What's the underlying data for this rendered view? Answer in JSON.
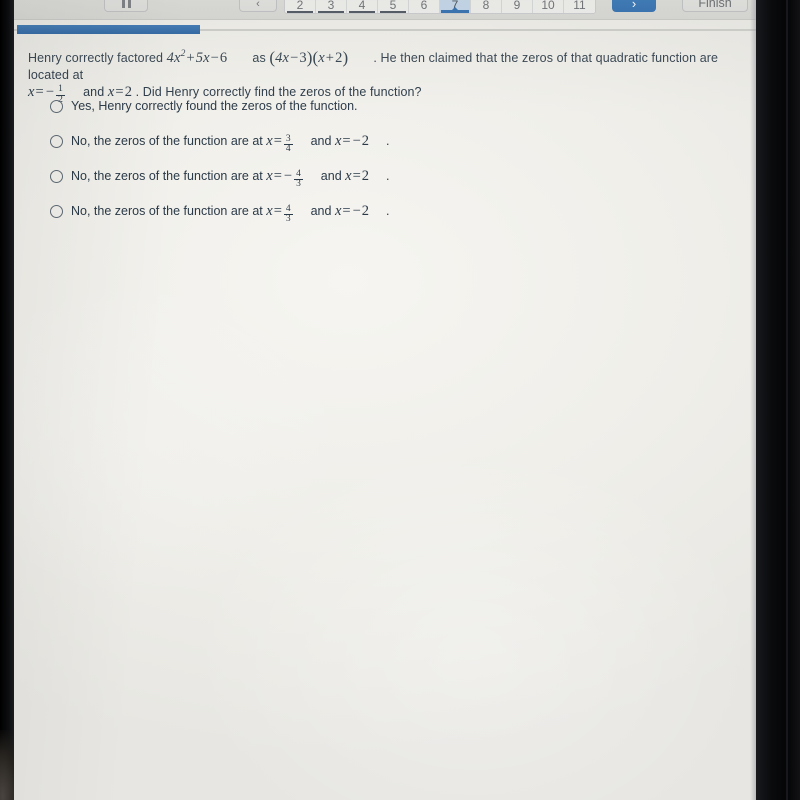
{
  "toolbar": {
    "pause_label": "pause-icon",
    "prev_label": "‹",
    "next_label": "›",
    "finish_label": "Finish",
    "pages": [
      "2",
      "3",
      "4",
      "5",
      "6",
      "7",
      "8",
      "9",
      "10",
      "11"
    ],
    "active_page": "7"
  },
  "progress": {
    "percent": 25
  },
  "question": {
    "lead": "Henry correctly factored",
    "expression": "4x² + 5x − 6",
    "connector": "as",
    "factored": "(4x − 3)(x + 2)",
    "period": ".",
    "middle": "He then claimed that the zeros of that quadratic function are located at",
    "zero1": "x = − 1/2",
    "and": "and",
    "zero2": "x = 2",
    "tail": ". Did Henry correctly find the zeros of the function?"
  },
  "options": [
    {
      "id": "option-a",
      "text": "Yes, Henry correctly found the zeros of the function.",
      "math": null
    },
    {
      "id": "option-b",
      "prefix": "No, the zeros of the function are at",
      "value1": "x = 3/4",
      "conj": "and",
      "value2": "x = −2",
      "suffix": "."
    },
    {
      "id": "option-c",
      "prefix": "No, the zeros of the function are at",
      "value1": "x = − 4/3",
      "conj": "and",
      "value2": "x = 2",
      "suffix": "."
    },
    {
      "id": "option-d",
      "prefix": "No, the zeros of the function are at",
      "value1": "x = 4/3",
      "conj": "and",
      "value2": "x = −2",
      "suffix": "."
    }
  ],
  "colors": {
    "accent": "#1a5fa8",
    "text": "#2b3a48",
    "toolbar_bg": "#d6d6d3",
    "screen_bg": "#efeee9"
  }
}
